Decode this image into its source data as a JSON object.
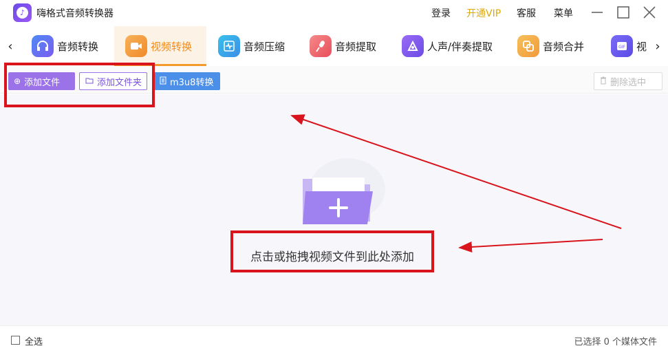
{
  "app": {
    "title": "嗨格式音频转换器",
    "logo_icon": "music-note-icon",
    "accent": "#8b5cf6"
  },
  "top_links": {
    "login": "登录",
    "vip": "开通VIP",
    "service": "客服",
    "menu": "菜单"
  },
  "tabs": [
    {
      "label": "音频转换",
      "icon": "headphones-icon",
      "color": "#5b7cf5",
      "active": false
    },
    {
      "label": "视频转换",
      "icon": "video-camera-icon",
      "color": "#f5a04a",
      "active": true
    },
    {
      "label": "音频压缩",
      "icon": "waveform-icon",
      "color": "#3bb8e6",
      "active": false
    },
    {
      "label": "音频提取",
      "icon": "microphone-icon",
      "color": "#f06565",
      "active": false
    },
    {
      "label": "人声/伴奏提取",
      "icon": "vocal-icon",
      "color": "#8b5cf6",
      "active": false
    },
    {
      "label": "音频合并",
      "icon": "merge-icon",
      "color": "#f5a04a",
      "active": false
    },
    {
      "label": "视",
      "icon": "gif-icon",
      "color": "#6b5cf0",
      "active": false
    }
  ],
  "toolbar": {
    "add_file": "添加文件",
    "add_folder": "添加文件夹",
    "m3u8": "m3u8转换",
    "delete_selected": "删除选中"
  },
  "main": {
    "drop_hint": "点击或拖拽视频文件到此处添加"
  },
  "footer": {
    "select_all": "全选",
    "status": "已选择 0 个媒体文件"
  },
  "colors": {
    "active_tab": "#f08c1e",
    "annotation": "#d9141c"
  }
}
